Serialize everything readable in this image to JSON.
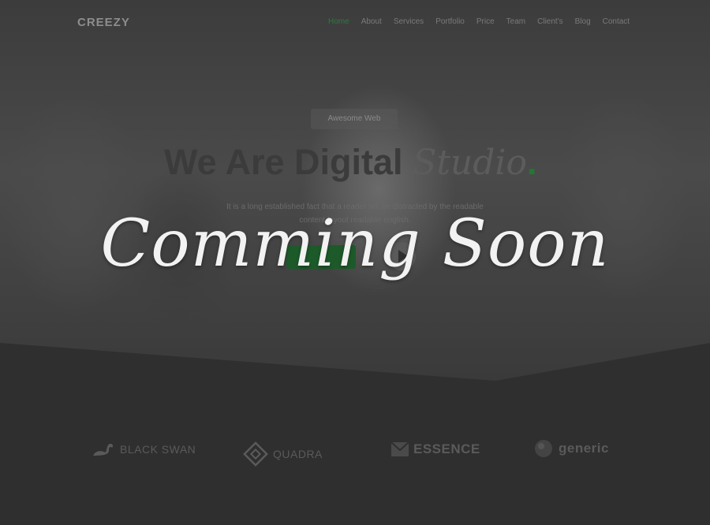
{
  "header": {
    "logo": "CREEZY",
    "menu": [
      "Home",
      "About",
      "Services",
      "Portfolio",
      "Price",
      "Team",
      "Client's",
      "Blog",
      "Contact"
    ],
    "active_index": 0
  },
  "hero": {
    "badge": "Awesome Web",
    "headline_bold": "We Are Digital ",
    "headline_script": "Studio",
    "headline_dot": ".",
    "subtitle_line1": "It is a long established fact that a reader will be distracted by the readable",
    "subtitle_line2": "content layout readable english.",
    "overlay_text": "Comming Soon"
  },
  "brands": [
    {
      "name": "BLACK SWAN",
      "icon": "swan-icon"
    },
    {
      "name": "QUADRA",
      "icon": "diamond-icon"
    },
    {
      "name": "ESSENCE",
      "icon": "envelope-icon"
    },
    {
      "name": "generic",
      "icon": "sphere-icon"
    }
  ],
  "colors": {
    "accent": "#1e7a32",
    "overlay_text": "#f2f2f2",
    "background": "#2f2f2f"
  }
}
